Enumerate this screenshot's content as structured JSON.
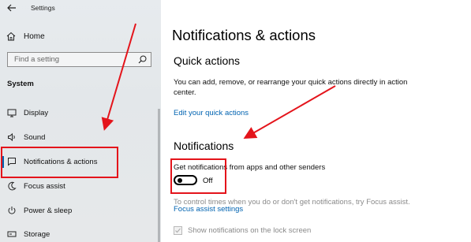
{
  "sidebar": {
    "app_title": "Settings",
    "home_label": "Home",
    "search_placeholder": "Find a setting",
    "section_label": "System",
    "items": [
      {
        "label": "Display"
      },
      {
        "label": "Sound"
      },
      {
        "label": "Notifications & actions",
        "active": true
      },
      {
        "label": "Focus assist"
      },
      {
        "label": "Power & sleep"
      },
      {
        "label": "Storage"
      }
    ]
  },
  "main": {
    "page_title": "Notifications & actions",
    "quick_actions": {
      "heading": "Quick actions",
      "description": "You can add, remove, or rearrange your quick actions directly in action center.",
      "link": "Edit your quick actions"
    },
    "notifications": {
      "heading": "Notifications",
      "toggle_label": "Get notifications from apps and other senders",
      "toggle_state": "Off",
      "toggle_on": false,
      "hint": "To control times when you do or don't get notifications, try Focus assist.",
      "hint_link": "Focus assist settings",
      "lock_screen_checkbox": "Show notifications on the lock screen",
      "lock_screen_checked": true
    }
  },
  "colors": {
    "accent": "#0063b1",
    "annotation": "#e4141b"
  }
}
